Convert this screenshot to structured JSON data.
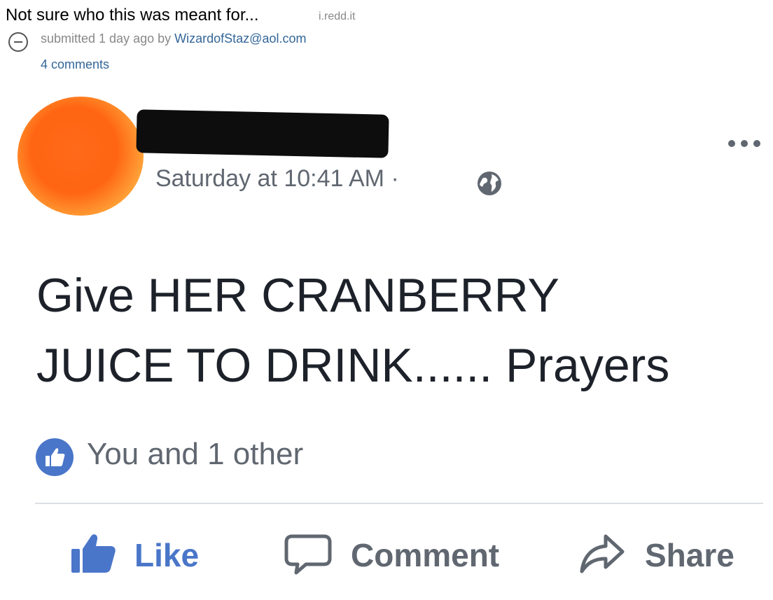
{
  "reddit": {
    "title": "Not sure who this was meant for...",
    "domain": "i.redd.it",
    "submitted_prefix": "submitted 1 day ago by",
    "author": "WizardofStaz@aol.com",
    "comments": "4 comments"
  },
  "post": {
    "timestamp": "Saturday at 10:41 AM",
    "separator": "·",
    "text_line1": "Give HER CRANBERRY",
    "text_line2": "JUICE TO DRINK...... Prayers",
    "reactions": "You and 1 other"
  },
  "actions": {
    "like": "Like",
    "comment": "Comment",
    "share": "Share"
  },
  "colors": {
    "facebook_blue": "#4a76c9",
    "reddit_link": "#336699",
    "muted_gray": "#606770"
  },
  "icons": [
    "collapse-icon",
    "globe-icon",
    "more-icon",
    "like-badge-icon",
    "thumbs-up-icon",
    "comment-icon",
    "share-icon"
  ]
}
